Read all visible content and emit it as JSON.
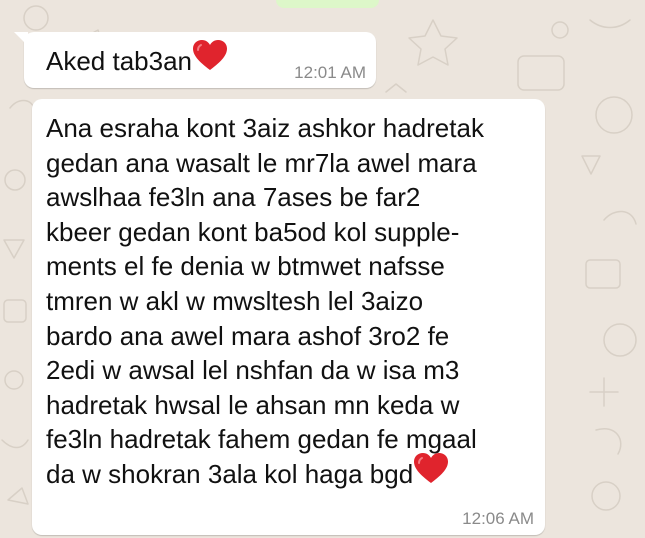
{
  "chat": {
    "messages": [
      {
        "text": "Aked tab3an",
        "emoji": "red-heart",
        "time": "12:01 AM"
      },
      {
        "text": "Ana esraha kont 3aiz ashkor hadretak\ngedan ana wasalt le mr7la awel mara\nawslhaa fe3ln ana 7ases be far2\nkbeer gedan kont ba5od kol supple-\nments el fe denia w btmwet nafsse\ntmren w akl w mwsltesh lel 3aizo\nbardo ana awel mara ashof 3ro2 fe\n2edi w awsal lel nshfan da w isa m3\nhadretak hwsal le ahsan mn keda w\nfe3ln hadretak fahem gedan fe mgaal\nda w shokran 3ala kol haga bgd",
        "emoji": "red-heart",
        "time": "12:06 AM"
      }
    ]
  },
  "colors": {
    "background": "#ece5dd",
    "incoming_bubble": "#ffffff",
    "outgoing_bubble": "#dcf8c6",
    "timestamp": "#8a8a8a",
    "heart": "#e0242d"
  }
}
